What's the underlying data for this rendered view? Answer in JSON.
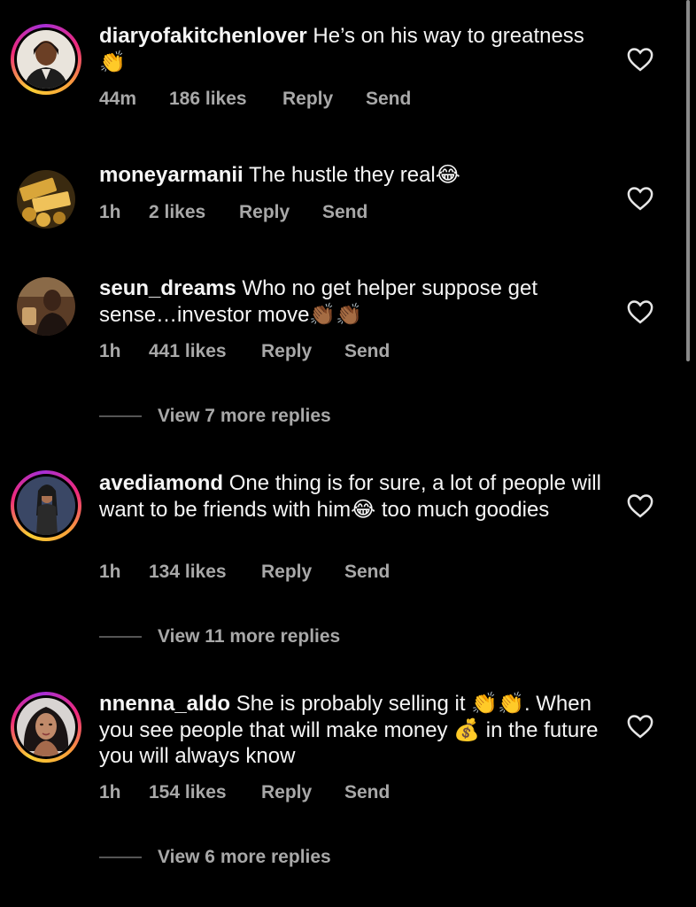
{
  "comments": [
    {
      "username": "diaryofakitchenlover",
      "text": "He’s on his way to greatness 👏",
      "time": "44m",
      "likes": "186 likes",
      "reply": "Reply",
      "send": "Send",
      "avatar_icon": "kitchen-chef-avatar-icon",
      "has_story_ring": true
    },
    {
      "username": "moneyarmanii",
      "text": "The hustle they real😂",
      "time": "1h",
      "likes": "2 likes",
      "reply": "Reply",
      "send": "Send",
      "avatar_icon": "gold-bars-avatar-icon",
      "has_story_ring": false
    },
    {
      "username": "seun_dreams",
      "text": "Who no get helper suppose get sense…investor move👏🏾👏🏾",
      "time": "1h",
      "likes": "441 likes",
      "reply": "Reply",
      "send": "Send",
      "avatar_icon": "person-photo-avatar-icon",
      "has_story_ring": false,
      "view_replies": "View 7 more replies"
    },
    {
      "username": "avediamond",
      "text": "One thing is for sure, a lot of people will want to be friends with him😂 too much goodies",
      "time": "1h",
      "likes": "134 likes",
      "reply": "Reply",
      "send": "Send",
      "avatar_icon": "woman-photo-avatar-icon",
      "has_story_ring": true,
      "view_replies": "View 11 more replies"
    },
    {
      "username": "nnenna_aldo",
      "text": "She is probably selling it 👏👏. When you see people that will make money 💰 in the future you will always know",
      "time": "1h",
      "likes": "154 likes",
      "reply": "Reply",
      "send": "Send",
      "avatar_icon": "woman-portrait-avatar-icon",
      "has_story_ring": true,
      "view_replies": "View 6 more replies"
    }
  ],
  "colors": {
    "background": "#000000",
    "primary_text": "#f5f5f5",
    "secondary_text": "#a8a8a8",
    "story_ring": [
      "#f9ce34",
      "#ee2a7b",
      "#a62fd6"
    ]
  }
}
